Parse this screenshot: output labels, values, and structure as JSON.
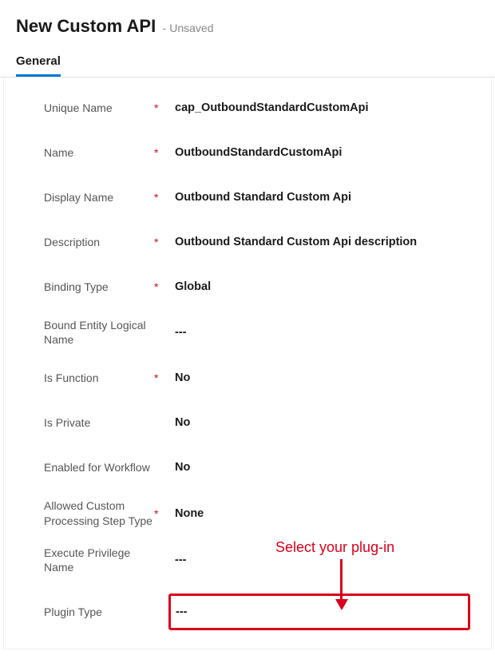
{
  "header": {
    "title": "New Custom API",
    "status": "- Unsaved"
  },
  "tabs": {
    "general": "General"
  },
  "fields": {
    "unique_name": {
      "label": "Unique Name",
      "required": "*",
      "value": "cap_OutboundStandardCustomApi"
    },
    "name": {
      "label": "Name",
      "required": "*",
      "value": "OutboundStandardCustomApi"
    },
    "display_name": {
      "label": "Display Name",
      "required": "*",
      "value": "Outbound Standard Custom Api"
    },
    "description": {
      "label": "Description",
      "required": "*",
      "value": "Outbound Standard Custom Api description"
    },
    "binding_type": {
      "label": "Binding Type",
      "required": "*",
      "value": "Global"
    },
    "bound_entity": {
      "label": "Bound Entity Logical Name",
      "required": "",
      "value": "---"
    },
    "is_function": {
      "label": "Is Function",
      "required": "*",
      "value": "No"
    },
    "is_private": {
      "label": "Is Private",
      "required": "",
      "value": "No"
    },
    "enabled_workflow": {
      "label": "Enabled for Workflow",
      "required": "",
      "value": "No"
    },
    "allowed_custom": {
      "label": "Allowed Custom Processing Step Type",
      "required": "*",
      "value": "None"
    },
    "execute_privilege": {
      "label": "Execute Privilege Name",
      "required": "",
      "value": "---"
    },
    "plugin_type": {
      "label": "Plugin Type",
      "required": "",
      "value": "---"
    }
  },
  "annotation": {
    "text": "Select your plug-in"
  }
}
